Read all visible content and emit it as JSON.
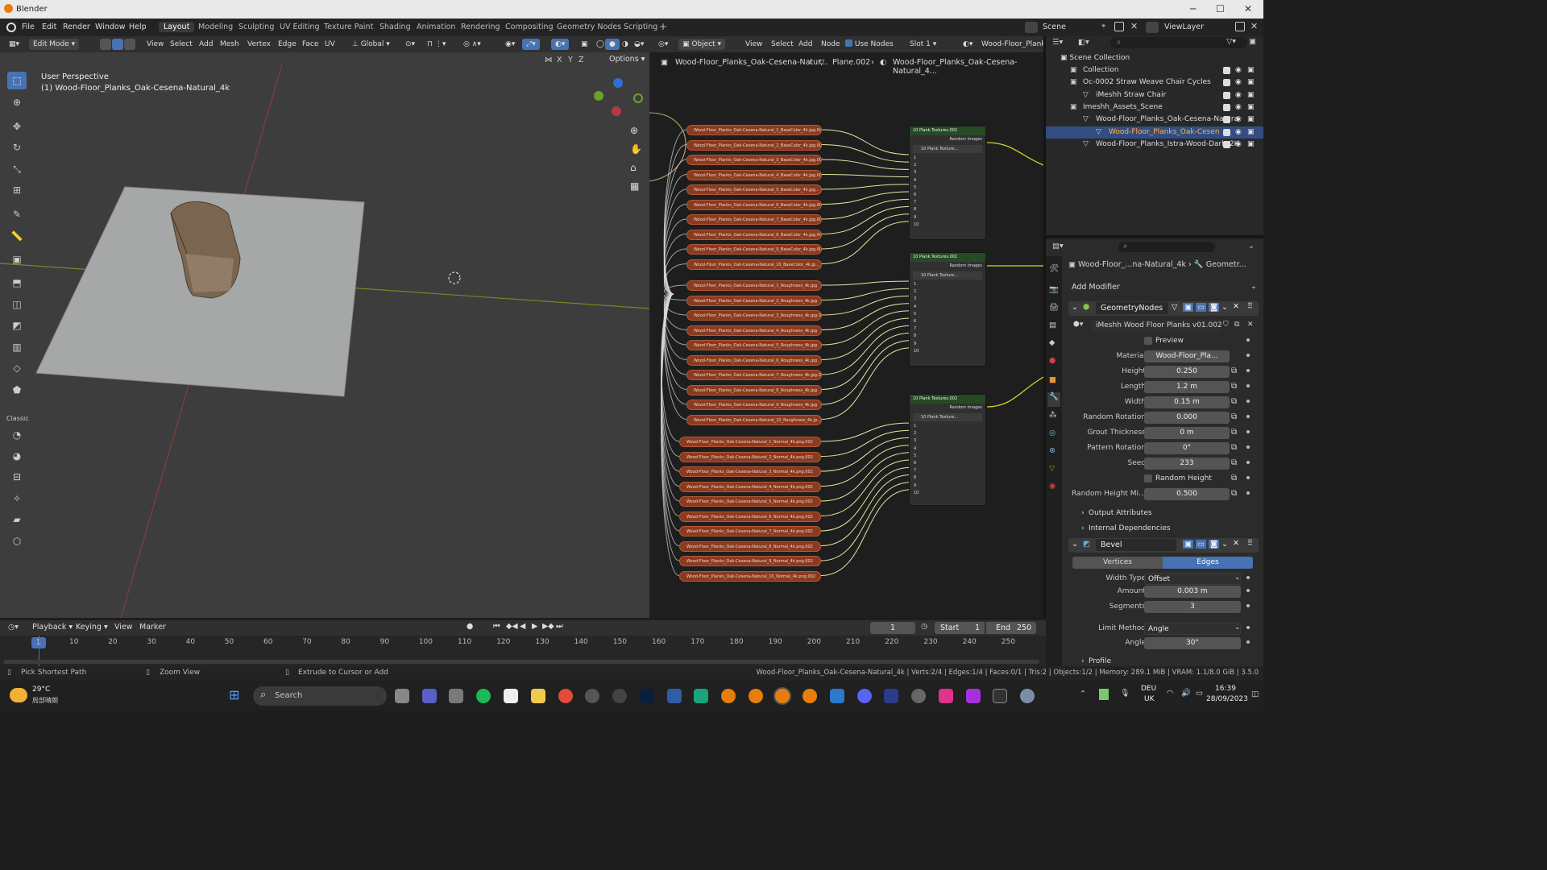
{
  "window": {
    "title": "Blender"
  },
  "menus": [
    "File",
    "Edit",
    "Render",
    "Window",
    "Help"
  ],
  "workspaces": [
    {
      "label": "Layout",
      "active": true
    },
    {
      "label": "Modeling"
    },
    {
      "label": "Sculpting"
    },
    {
      "label": "UV Editing"
    },
    {
      "label": "Texture Paint"
    },
    {
      "label": "Shading"
    },
    {
      "label": "Animation"
    },
    {
      "label": "Rendering"
    },
    {
      "label": "Compositing"
    },
    {
      "label": "Geometry Nodes"
    },
    {
      "label": "Scripting"
    }
  ],
  "scene": {
    "label": "Scene",
    "view_layer": "ViewLayer"
  },
  "viewport": {
    "mode": "Edit Mode",
    "menus": [
      "View",
      "Select",
      "Add",
      "Mesh",
      "Vertex",
      "Edge",
      "Face",
      "UV"
    ],
    "transform_orientation": "Global",
    "options_label": "Options",
    "axes": [
      "X",
      "Y",
      "Z"
    ],
    "perspective": "User Perspective",
    "object_label": "(1) Wood-Floor_Planks_Oak-Cesena-Natural_4k",
    "tool_section": "Classic"
  },
  "node_editor": {
    "object_mode": "Object",
    "menus": [
      "View",
      "Select",
      "Add",
      "Node"
    ],
    "use_nodes_label": "Use Nodes",
    "slot": "Slot 1",
    "material_name": "Wood-Floor_Planks_",
    "breadcrumb": [
      "Wood-Floor_Planks_Oak-Cesena-Natur...",
      "Plane.002",
      "Wood-Floor_Planks_Oak-Cesena-Natural_4..."
    ],
    "basecolor_nodes": [
      "Wood-Floor_Planks_Oak-Cesena-Natural_1_BaseColor_4k.jpg.002",
      "Wood-Floor_Planks_Oak-Cesena-Natural_2_BaseColor_4k.jpg.002",
      "Wood-Floor_Planks_Oak-Cesena-Natural_3_BaseColor_4k.jpg.002",
      "Wood-Floor_Planks_Oak-Cesena-Natural_4_BaseColor_4k.jpg.002",
      "Wood-Floor_Planks_Oak-Cesena-Natural_5_BaseColor_4k.jpg...",
      "Wood-Floor_Planks_Oak-Cesena-Natural_6_BaseColor_4k.jpg.002",
      "Wood-Floor_Planks_Oak-Cesena-Natural_7_BaseColor_4k.jpg.002",
      "Wood-Floor_Planks_Oak-Cesena-Natural_8_BaseColor_4k.jpg.002",
      "Wood-Floor_Planks_Oak-Cesena-Natural_9_BaseColor_4k.jpg.002",
      "Wood-Floor_Planks_Oak-Cesena-Natural_10_BaseColor_4k.jp..."
    ],
    "roughness_nodes": [
      "Wood-Floor_Planks_Oak-Cesena-Natural_1_Roughness_4k.jpg",
      "Wood-Floor_Planks_Oak-Cesena-Natural_2_Roughness_4k.jpg",
      "Wood-Floor_Planks_Oak-Cesena-Natural_3_Roughness_4k.jpg.0...",
      "Wood-Floor_Planks_Oak-Cesena-Natural_4_Roughness_4k.jpg",
      "Wood-Floor_Planks_Oak-Cesena-Natural_5_Roughness_4k.jpg",
      "Wood-Floor_Planks_Oak-Cesena-Natural_6_Roughness_4k.jpg",
      "Wood-Floor_Planks_Oak-Cesena-Natural_7_Roughness_4k.jpg.0...",
      "Wood-Floor_Planks_Oak-Cesena-Natural_8_Roughness_4k.jpg",
      "Wood-Floor_Planks_Oak-Cesena-Natural_9_Roughness_4k.jpg",
      "Wood-Floor_Planks_Oak-Cesena-Natural_10_Roughness_4k.jp..."
    ],
    "normal_nodes": [
      "Wood-Floor_Planks_Oak-Cesena-Natural_1_Normal_4k.png.002",
      "Wood-Floor_Planks_Oak-Cesena-Natural_2_Normal_4k.png.002",
      "Wood-Floor_Planks_Oak-Cesena-Natural_3_Normal_4k.png.002",
      "Wood-Floor_Planks_Oak-Cesena-Natural_4_Normal_4k.png.002",
      "Wood-Floor_Planks_Oak-Cesena-Natural_5_Normal_4k.png.002",
      "Wood-Floor_Planks_Oak-Cesena-Natural_6_Normal_4k.png.002",
      "Wood-Floor_Planks_Oak-Cesena-Natural_7_Normal_4k.png.002",
      "Wood-Floor_Planks_Oak-Cesena-Natural_8_Normal_4k.png.002",
      "Wood-Floor_Planks_Oak-Cesena-Natural_9_Normal_4k.png.002",
      "Wood-Floor_Planks_Oak-Cesena-Natural_10_Normal_4k.png.002"
    ],
    "group_node": {
      "title": "10 Plank Textures.002",
      "output": "Random Images",
      "inner": "10 Plank Texture...",
      "sockets": [
        "1",
        "2",
        "3",
        "4",
        "5",
        "6",
        "7",
        "8",
        "9",
        "10"
      ]
    }
  },
  "outliner": {
    "root": "Scene Collection",
    "items": [
      {
        "label": "Collection",
        "indent": 1
      },
      {
        "label": "Oc-0002 Straw Weave Chair Cycles",
        "indent": 1
      },
      {
        "label": "iMeshh Straw Chair",
        "indent": 2
      },
      {
        "label": "Imeshh_Assets_Scene",
        "indent": 1
      },
      {
        "label": "Wood-Floor_Planks_Oak-Cesena-Natura",
        "indent": 2
      },
      {
        "label": "Wood-Floor_Planks_Oak-Cesen",
        "indent": 3,
        "selected": true
      },
      {
        "label": "Wood-Floor_Planks_Istra-Wood-Dark_2K",
        "indent": 2
      }
    ]
  },
  "properties": {
    "breadcrumb": [
      "Wood-Floor_...na-Natural_4k",
      "Geometr..."
    ],
    "add_modifier": "Add Modifier",
    "modifier_name": "GeometryNodes",
    "node_group": "iMeshh Wood Floor Planks v01.002",
    "preview_label": "Preview",
    "fields": [
      {
        "label": "Material",
        "value": "Wood-Floor_Pla..."
      },
      {
        "label": "Height",
        "value": "0.250"
      },
      {
        "label": "Length",
        "value": "1.2 m"
      },
      {
        "label": "Width",
        "value": "0.15 m"
      },
      {
        "label": "Random Rotation",
        "value": "0.000"
      },
      {
        "label": "Grout Thickness",
        "value": "0 m"
      },
      {
        "label": "Pattern Rotation",
        "value": "0°"
      },
      {
        "label": "Seed",
        "value": "233"
      }
    ],
    "random_height_label": "Random Height",
    "random_height_mix": {
      "label": "Random Height Mi...",
      "value": "0.500"
    },
    "output_attributes": "Output Attributes",
    "internal_dependencies": "Internal Dependencies",
    "bevel": {
      "name": "Bevel",
      "tabs": [
        "Vertices",
        "Edges"
      ],
      "active_tab": "Edges",
      "fields": [
        {
          "label": "Width Type",
          "value": "Offset"
        },
        {
          "label": "Amount",
          "value": "0.003 m"
        },
        {
          "label": "Segments",
          "value": "3"
        },
        {
          "label": "Limit Method",
          "value": "Angle"
        },
        {
          "label": "Angle",
          "value": "30°"
        }
      ],
      "profile": "Profile"
    }
  },
  "timeline": {
    "menus": [
      "Playback",
      "Keying",
      "View",
      "Marker"
    ],
    "current_frame": "1",
    "start_label": "Start",
    "start": "1",
    "end_label": "End",
    "end": "250",
    "ticks": [
      "10",
      "20",
      "30",
      "40",
      "50",
      "60",
      "70",
      "80",
      "90",
      "100",
      "110",
      "120",
      "130",
      "140",
      "150",
      "160",
      "170",
      "180",
      "190",
      "200",
      "210",
      "220",
      "230",
      "240",
      "250"
    ]
  },
  "statusbar": {
    "hints": [
      "Pick Shortest Path",
      "Zoom View",
      "Extrude to Cursor or Add"
    ],
    "stats": "Wood-Floor_Planks_Oak-Cesena-Natural_4k | Verts:2/4 | Edges:1/4 | Faces:0/1 | Tris:2 | Objects:1/2 | Memory: 289.1 MiB | VRAM: 1.1/8.0 GiB | 3.5.0"
  },
  "taskbar": {
    "weather_temp": "29°C",
    "weather_text": "局部晴朗",
    "search_placeholder": "Search",
    "lang": "DEU",
    "region": "UK",
    "time": "16:39",
    "date": "28/09/2023"
  }
}
